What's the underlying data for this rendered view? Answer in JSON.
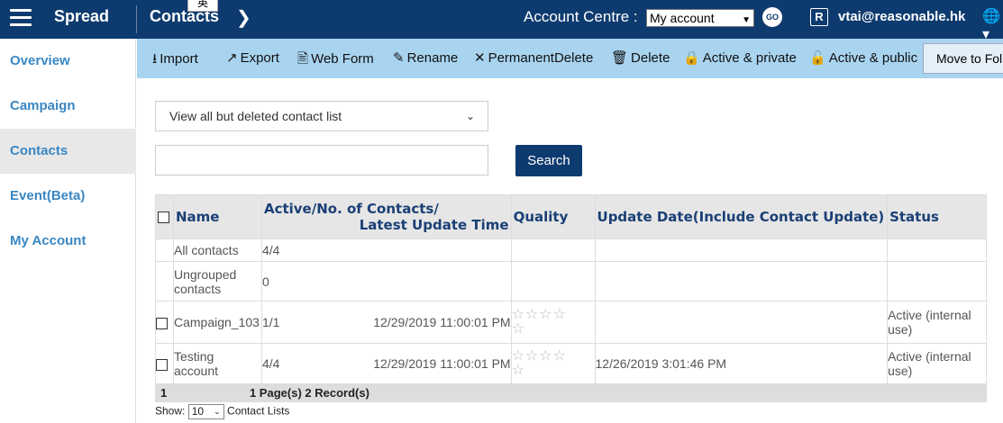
{
  "header": {
    "brand": "Spread",
    "breadcrumb": "Contacts",
    "tooltip_char": "英",
    "account_label": "Account Centre :",
    "account_select": "My account",
    "go_label": "GO",
    "r_badge": "R",
    "user_email": "vtai@reasonable.hk"
  },
  "sidebar": {
    "items": [
      {
        "label": "Overview"
      },
      {
        "label": "Campaign"
      },
      {
        "label": "Contacts"
      },
      {
        "label": "Event(Beta)"
      },
      {
        "label": "My Account"
      }
    ]
  },
  "toolbar": {
    "import": "Import",
    "export": "Export",
    "web_form": "Web Form",
    "rename": "Rename",
    "permanent_delete": "PermanentDelete",
    "delete": "Delete",
    "active_private": "Active & private",
    "active_public": "Active & public",
    "move_to": "Move to Fol"
  },
  "filter": {
    "selected": "View all but deleted contact list"
  },
  "search": {
    "button": "Search",
    "value": ""
  },
  "table": {
    "headers": {
      "name": "Name",
      "active_line1": "Active/No. of Contacts/",
      "active_line2": "Latest Update Time",
      "quality": "Quality",
      "update_date": "Update Date(Include Contact Update)",
      "status": "Status"
    },
    "rows": [
      {
        "name": "All contacts",
        "count": "4/4",
        "time": "",
        "update": "",
        "status": ""
      },
      {
        "name": "Ungrouped contacts",
        "count": "0",
        "time": "",
        "update": "",
        "status": ""
      },
      {
        "name": "Campaign_103",
        "count": "1/1",
        "time": "12/29/2019 11:00:01 PM",
        "update": "",
        "status": "Active (internal use)",
        "quality_stars": 0
      },
      {
        "name": "Testing account",
        "count": "4/4",
        "time": "12/29/2019 11:00:01 PM",
        "update": "12/26/2019 3:01:46 PM",
        "status": "Active (internal use)",
        "quality_stars": 0
      }
    ],
    "footer": {
      "page": "1",
      "pages": "1 Page(s)",
      "records": "2 Record(s)"
    }
  },
  "pager": {
    "show_label": "Show:",
    "page_size": "10",
    "suffix": "Contact Lists"
  }
}
